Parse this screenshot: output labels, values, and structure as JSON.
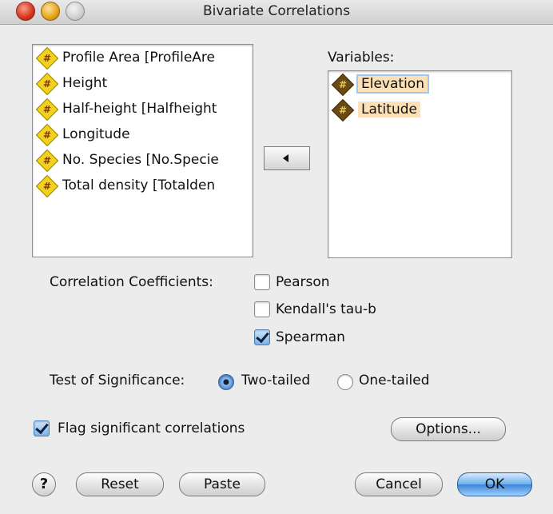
{
  "window": {
    "title": "Bivariate Correlations"
  },
  "source_list": {
    "items": [
      {
        "label": "Profile Area [ProfileAre"
      },
      {
        "label": "Height"
      },
      {
        "label": "Half-height [Halfheight"
      },
      {
        "label": "Longitude"
      },
      {
        "label": "No. Species [No.Specie"
      },
      {
        "label": "Total density [Totalden"
      }
    ]
  },
  "variables": {
    "heading": "Variables:",
    "items": [
      {
        "label": "Elevation"
      },
      {
        "label": "Latitude"
      }
    ]
  },
  "icons": {
    "numeric_variable": "#"
  },
  "coefficients": {
    "label": "Correlation Coefficients:",
    "pearson": {
      "label": "Pearson",
      "checked": false
    },
    "kendall": {
      "label": "Kendall's tau-b",
      "checked": false
    },
    "spearman": {
      "label": "Spearman",
      "checked": true
    }
  },
  "significance": {
    "label": "Test of Significance:",
    "options": [
      {
        "label": "Two-tailed",
        "selected": true
      },
      {
        "label": "One-tailed",
        "selected": false
      }
    ]
  },
  "flag": {
    "label": "Flag significant correlations",
    "checked": true
  },
  "buttons": {
    "help": "?",
    "options": "Options...",
    "reset": "Reset",
    "paste": "Paste",
    "cancel": "Cancel",
    "ok": "OK"
  },
  "colors": {
    "selection_highlight": "#fde0b5",
    "default_button": "#3a86d6"
  }
}
